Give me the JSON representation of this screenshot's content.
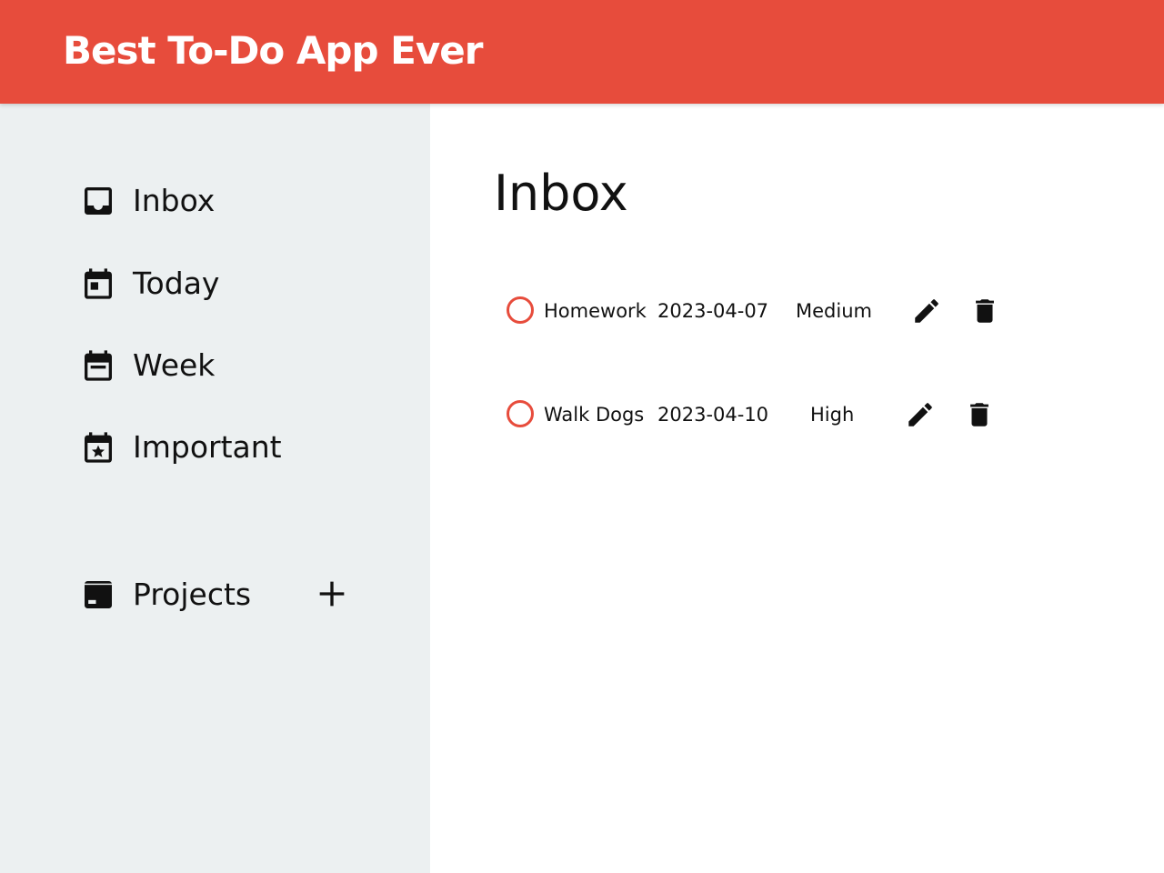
{
  "app": {
    "title": "Best To-Do App Ever",
    "accent_color": "#e74c3c",
    "sidebar_color": "#ecf0f1"
  },
  "sidebar": {
    "items": [
      {
        "label": "Inbox",
        "icon": "inbox-icon"
      },
      {
        "label": "Today",
        "icon": "calendar-today-icon"
      },
      {
        "label": "Week",
        "icon": "calendar-week-icon"
      },
      {
        "label": "Important",
        "icon": "calendar-star-icon"
      }
    ],
    "projects": {
      "label": "Projects",
      "icon": "projects-icon",
      "add_icon": "plus-icon"
    }
  },
  "main": {
    "title": "Inbox",
    "tasks": [
      {
        "name": "Homework",
        "date": "2023-04-07",
        "priority": "Medium",
        "edit_icon": "pencil-icon",
        "delete_icon": "trash-icon"
      },
      {
        "name": "Walk Dogs",
        "date": "2023-04-10",
        "priority": "High",
        "edit_icon": "pencil-icon",
        "delete_icon": "trash-icon"
      }
    ]
  }
}
